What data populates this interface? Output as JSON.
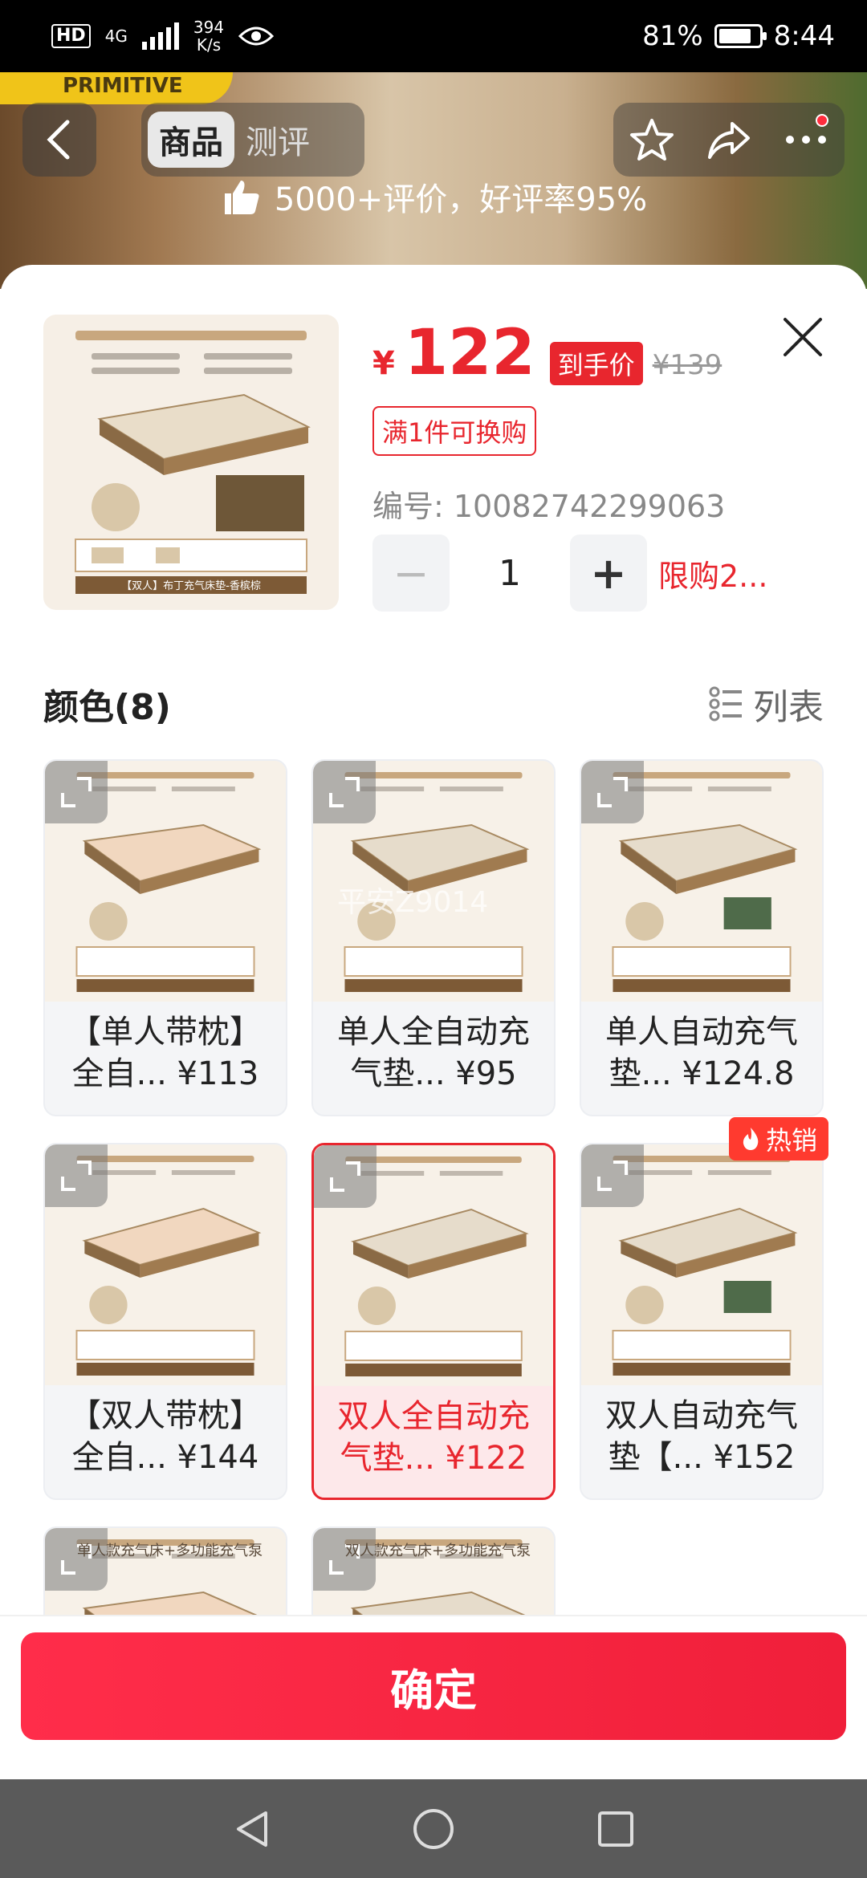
{
  "status_bar": {
    "hd": "HD",
    "network": "4G",
    "speed_value": "394",
    "speed_unit": "K/s",
    "battery": "81%",
    "time": "8:44",
    "battery_level": 0.81
  },
  "banner": {
    "brand_text": "PRIMITIVE",
    "review_text": "5000+评价，好评率95%"
  },
  "nav": {
    "tabs": [
      {
        "label": "商品",
        "active": true
      },
      {
        "label": "测评",
        "active": false
      }
    ]
  },
  "product": {
    "thumb_caption": "【双人】布丁充气床垫-香槟棕",
    "currency": "¥",
    "price": "122",
    "price_tag": "到手价",
    "old_price": "¥139",
    "promo": "满1件可换购",
    "serial": "编号: 10082742299063",
    "quantity": "1",
    "limit": "限购2..."
  },
  "section": {
    "title": "颜色(8)",
    "list_label": "列表"
  },
  "variants": [
    {
      "line1": "【单人带枕】",
      "line2": "全自... ¥113",
      "selected": false
    },
    {
      "line1": "单人全自动充",
      "line2": "气垫... ¥95",
      "selected": false
    },
    {
      "line1": "单人自动充气",
      "line2": "垫... ¥124.8",
      "selected": false
    },
    {
      "line1": "【双人带枕】",
      "line2": "全自... ¥144",
      "selected": false
    },
    {
      "line1": "双人全自动充",
      "line2": "气垫... ¥122",
      "selected": true
    },
    {
      "line1": "双人自动充气",
      "line2": "垫【... ¥152",
      "selected": false
    },
    {
      "line1": "单人款充气床+多功能充气泵",
      "line2": "",
      "selected": false
    },
    {
      "line1": "双人款充气床+多功能充气泵",
      "line2": "",
      "selected": false
    }
  ],
  "hot_badge": "热销",
  "watermark": "平安Z9014",
  "confirm_label": "确定",
  "colors": {
    "accent": "#e8262e"
  }
}
